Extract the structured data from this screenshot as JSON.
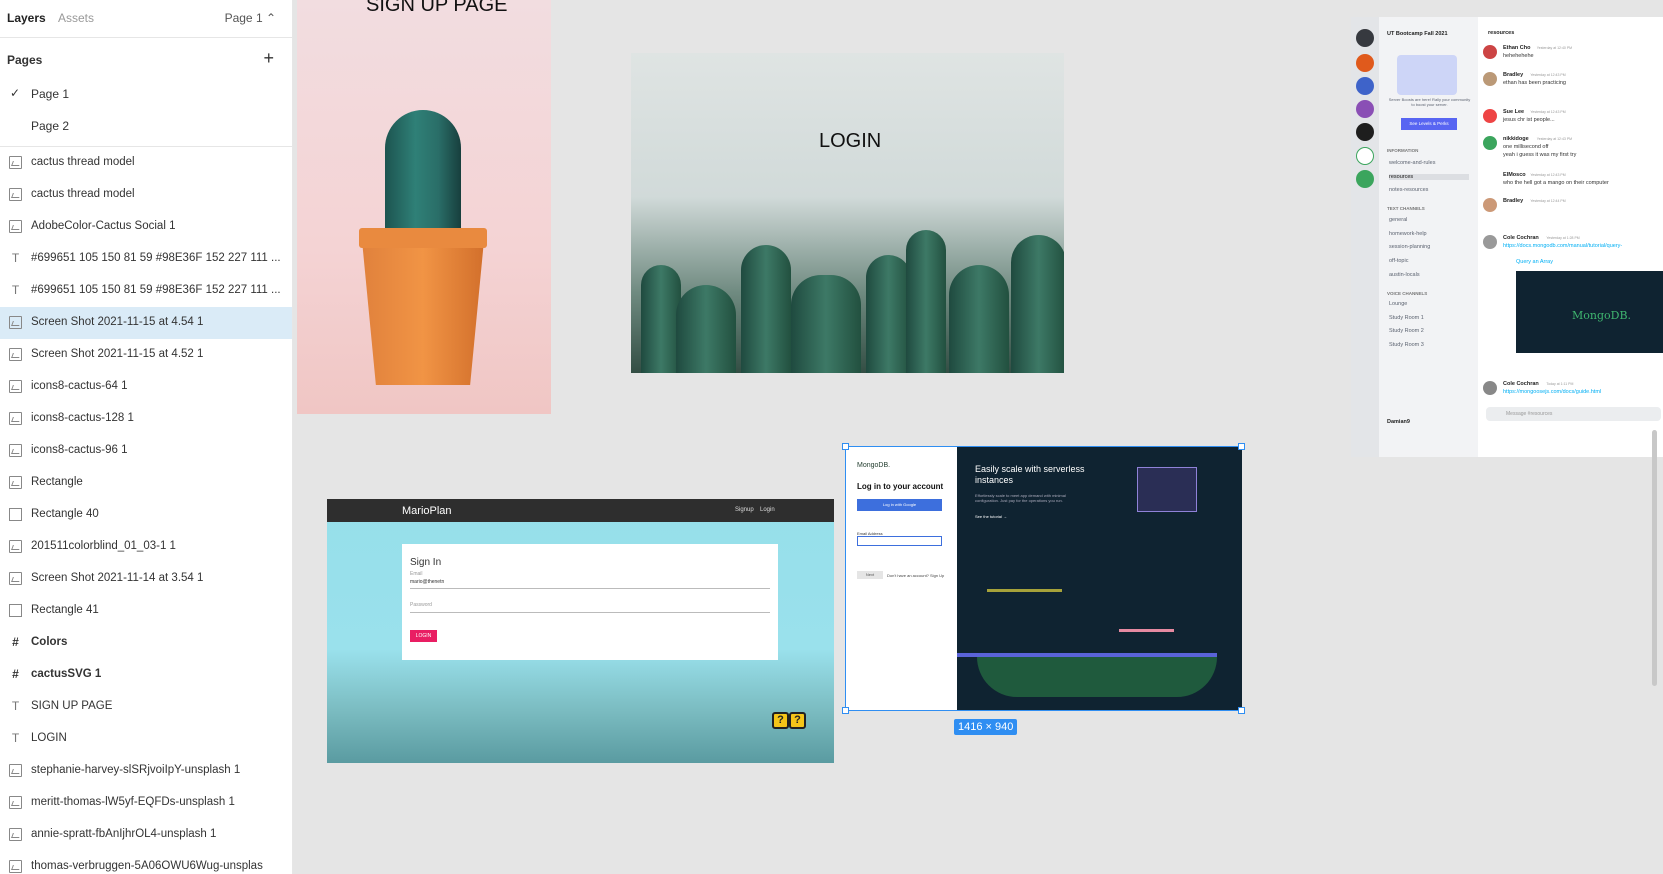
{
  "sidebar": {
    "tabs": {
      "layers": "Layers",
      "assets": "Assets"
    },
    "page_selector": "Page 1 ⌃",
    "pages_heading": "Pages",
    "add_page": "+",
    "pages": [
      {
        "label": "Page 1",
        "check": "✓"
      },
      {
        "label": "Page 2",
        "check": ""
      }
    ],
    "layers": [
      {
        "name": "cactus thread model",
        "icon": "image-icon"
      },
      {
        "name": "cactus thread model",
        "icon": "image-icon"
      },
      {
        "name": "AdobeColor-Cactus Social 1",
        "icon": "image-icon"
      },
      {
        "name": "#699651 105 150 81 59 #98E36F 152 227 111 ...",
        "icon": "text-icon"
      },
      {
        "name": "#699651 105 150 81 59 #98E36F 152 227 111 ...",
        "icon": "text-icon"
      },
      {
        "name": "Screen Shot 2021-11-15 at 4.54 1",
        "icon": "image-icon",
        "selected": true
      },
      {
        "name": "Screen Shot 2021-11-15 at 4.52 1",
        "icon": "image-icon"
      },
      {
        "name": "icons8-cactus-64 1",
        "icon": "image-icon"
      },
      {
        "name": "icons8-cactus-128 1",
        "icon": "image-icon"
      },
      {
        "name": "icons8-cactus-96 1",
        "icon": "image-icon"
      },
      {
        "name": "Rectangle",
        "icon": "image-icon"
      },
      {
        "name": "Rectangle 40",
        "icon": "rectangle-icon"
      },
      {
        "name": "201511colorblind_01_03-1 1",
        "icon": "image-icon"
      },
      {
        "name": "Screen Shot 2021-11-14 at 3.54 1",
        "icon": "image-icon"
      },
      {
        "name": "Rectangle 41",
        "icon": "rectangle-icon"
      },
      {
        "name": "Colors",
        "icon": "frame-icon",
        "bold": true
      },
      {
        "name": "cactusSVG 1",
        "icon": "frame-icon",
        "bold": true
      },
      {
        "name": "SIGN UP PAGE",
        "icon": "text-icon"
      },
      {
        "name": "LOGIN",
        "icon": "text-icon"
      },
      {
        "name": "stephanie-harvey-slSRjvoiIpY-unsplash 1",
        "icon": "image-icon"
      },
      {
        "name": "meritt-thomas-lW5yf-EQFDs-unsplash 1",
        "icon": "image-icon"
      },
      {
        "name": "annie-spratt-fbAnIjhrOL4-unsplash 1",
        "icon": "image-icon"
      },
      {
        "name": "thomas-verbruggen-5A06OWU6Wug-unsplas",
        "icon": "image-icon"
      }
    ]
  },
  "canvas": {
    "signup_title": "SIGN UP PAGE",
    "login_title": "LOGIN",
    "mario": {
      "brand": "MarioPlan",
      "nav_signup": "Signup",
      "nav_login": "Login",
      "sign_in": "Sign In",
      "email_label": "Email",
      "email_value": "mario@thenetn",
      "password_label": "Password",
      "login_button": "LOGIN",
      "qblock": "?"
    },
    "mongo": {
      "logo": "MongoDB.",
      "heading": "Log in to your account",
      "google_button": "Log in with Google",
      "email_label": "Email Address",
      "next_button": "Next",
      "no_account": "Don't have an account? Sign Up",
      "hero_title": "Easily scale with serverless instances",
      "hero_sub": "Effortlessly scale to meet app demand with minimal configuration. Just pay for the operations you run.",
      "tutorial": "See the tutorial →"
    },
    "selection_dims": "1416 × 940",
    "discord": {
      "server_name": "UT Bootcamp Fall 2021",
      "channel_header": "resources",
      "boost_text": "Server Boosts are here! Rally your community to boost your server.",
      "boost_button": "See Levels & Perks",
      "categories": {
        "information": "INFORMATION",
        "text": "TEXT CHANNELS",
        "voice": "VOICE CHANNELS"
      },
      "channels": [
        "welcome-and-rules",
        "resources",
        "notes-resources",
        "general",
        "homework-help",
        "session-planning",
        "off-topic",
        "austin-locals"
      ],
      "voice": [
        "Lounge",
        "Study Room 1",
        "Study Room 2",
        "Study Room 3"
      ],
      "user": "Damian9",
      "messages": [
        {
          "user": "Ethan Cho",
          "time": "Yesterday at 12:40 PM",
          "text": "hehehehehe"
        },
        {
          "user": "Bradley",
          "time": "Yesterday at 12:43 PM",
          "text": "ethan has been practicing"
        },
        {
          "user": "Sue Lee",
          "time": "Yesterday at 12:43 PM",
          "text": "jesus chr ist people..."
        },
        {
          "user": "nikkidoge",
          "time": "Yesterday at 12:43 PM",
          "text": "one millisecond off"
        },
        {
          "user": "",
          "time": "",
          "text": "yeah i guess it was my first try"
        },
        {
          "user": "ElMosco",
          "time": "Yesterday at 12:43 PM",
          "text": "who the hell got a mango on their computer"
        },
        {
          "user": "Bradley",
          "time": "Yesterday at 12:44 PM",
          "text": ""
        },
        {
          "user": "Cole Cochran",
          "time": "Yesterday at 1:28 PM",
          "text": "https://docs.mongodb.com/manual/tutorial/query-"
        },
        {
          "user": "Cole Cochran",
          "time": "Today at 1:11 PM",
          "text": "https://mongoosejs.com/docs/guide.html"
        }
      ],
      "embed_title": "Query an Array",
      "embed_brand": "MongoDB.",
      "message_placeholder": "Message #resources"
    }
  }
}
